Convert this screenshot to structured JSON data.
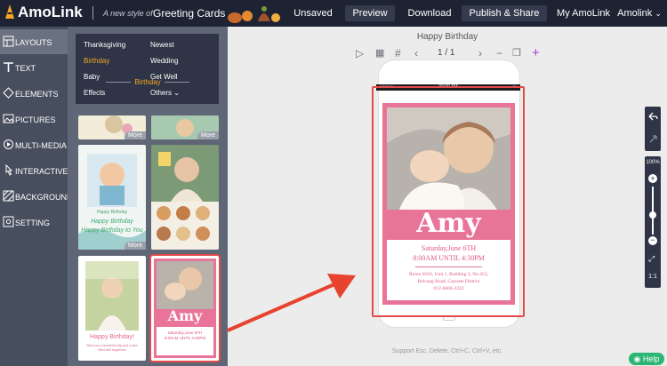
{
  "app": {
    "logo_text": "AmoLink",
    "tagline": "A new style of",
    "category": "Greeting Cards",
    "nav": {
      "unsaved": "Unsaved",
      "preview": "Preview",
      "download": "Download",
      "publish": "Publish & Share",
      "my_amolink": "My AmoLink",
      "user": "Amolink"
    }
  },
  "sidebar": {
    "items": [
      {
        "label": "LAYOUTS",
        "icon": "layouts-icon"
      },
      {
        "label": "TEXT",
        "icon": "text-icon"
      },
      {
        "label": "ELEMENTS",
        "icon": "elements-icon"
      },
      {
        "label": "PICTURES",
        "icon": "pictures-icon"
      },
      {
        "label": "MULTI-MEDIA",
        "icon": "multimedia-icon"
      },
      {
        "label": "INTERACTIVE",
        "icon": "interactive-icon"
      },
      {
        "label": "BACKGROUND",
        "icon": "background-icon"
      },
      {
        "label": "SETTING",
        "icon": "setting-icon"
      }
    ]
  },
  "categories": {
    "col1": [
      "Thanksgiving",
      "Birthday",
      "Baby",
      "Effects"
    ],
    "col2": [
      "Newest",
      "Wedding",
      "Get Well",
      "Others"
    ],
    "selected": "Birthday"
  },
  "templates": {
    "section_title": "Birthday",
    "more_label": "More",
    "t1_line1": "Happy Birthday",
    "t1_line2": "Happy Birthday",
    "t1_line3": "Happy Birthday to You",
    "t3_title": "Happy Birthday!",
    "t3_sub": "Wish you a wonderful day and a year filled with happiness",
    "t4_name": "Amy",
    "t4_line1": "Saturday,June 6TH",
    "t4_line2": "8:00AM UNTIL 4:30PM"
  },
  "editor": {
    "doc_title": "Happy Birthday",
    "page_indicator": "1 / 1",
    "zoom": "100%",
    "ratio": "1:1",
    "support_text": "Support Esc, Delete, Ctrl+C, Ctrl+V, etc.",
    "help": "Help",
    "status_time": "09:00 AM"
  },
  "card": {
    "name": "Amy",
    "date_line": "Saturday,June 6TH",
    "time_line": "8:00AM UNTIL 4:30PM",
    "address_1": "Room 0503, Unit 1, Building 3, No.453,",
    "address_2": "Beicang Road, Caynate District",
    "address_3": "012-6666-2222"
  },
  "colors": {
    "topbar": "#1d2333",
    "accent_orange": "#f5a623",
    "card_pink": "#e97499",
    "selection_red": "#e34b4b",
    "help_green": "#2bb673",
    "plus_purple": "#a63fd8"
  }
}
